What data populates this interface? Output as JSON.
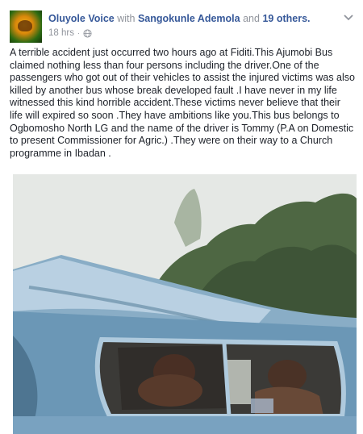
{
  "post": {
    "page_name": "Oluyole Voice",
    "with_word": "with",
    "tagged_person": "Sangokunle Ademola",
    "and_word": "and",
    "others": "19 others.",
    "timestamp": "18 hrs",
    "separator": "·",
    "privacy_icon": "globe-icon",
    "menu_icon": "chevron-down-icon",
    "text": "A terrible accident just occurred two hours ago at Fiditi.This Ajumobi Bus claimed nothing less than four persons including the driver.One of the passengers who got out of their vehicles to assist the injured victims was also killed by another bus whose break developed fault .I have never in my life witnessed this kind horrible accident.These victims never believe that their life will expired so soon .They have ambitions like you.This bus belongs to Ogbomosho North LG and the name of the driver is Tommy (P.A on Domestic to present Commissioner for Agric.) .They were on their way to a Church programme in Ibadan ."
  },
  "colors": {
    "link": "#365899",
    "meta": "#90949c",
    "text": "#1d2129"
  }
}
